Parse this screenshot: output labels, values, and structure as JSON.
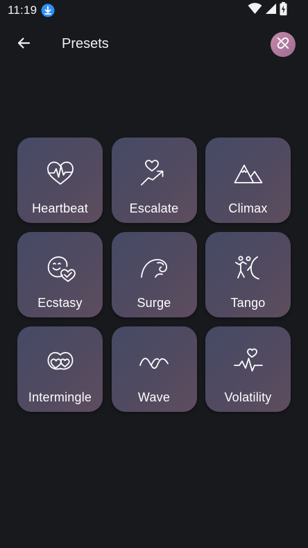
{
  "status_bar": {
    "time": "11:19",
    "icons": [
      "download-icon",
      "wifi-icon",
      "signal-icon",
      "battery-icon"
    ]
  },
  "app_bar": {
    "back_icon": "arrow-back-icon",
    "title": "Presets",
    "action_icon": "link-off-icon"
  },
  "colors": {
    "background": "#17191d",
    "tile_gradient_start": "#454a66",
    "tile_gradient_end": "#5e4d5e",
    "accent": "#c38bab",
    "download_badge": "#2f8ff5"
  },
  "presets": [
    {
      "label": "Heartbeat",
      "icon": "heartbeat-icon"
    },
    {
      "label": "Escalate",
      "icon": "heart-rising-arrow-icon"
    },
    {
      "label": "Climax",
      "icon": "mountain-peaks-icon"
    },
    {
      "label": "Ecstasy",
      "icon": "smiley-heart-icon"
    },
    {
      "label": "Surge",
      "icon": "ocean-wave-icon"
    },
    {
      "label": "Tango",
      "icon": "dancing-figure-icon"
    },
    {
      "label": "Intermingle",
      "icon": "intertwined-hearts-icon"
    },
    {
      "label": "Wave",
      "icon": "sine-wave-icon"
    },
    {
      "label": "Volatility",
      "icon": "heart-pulse-line-icon"
    }
  ]
}
